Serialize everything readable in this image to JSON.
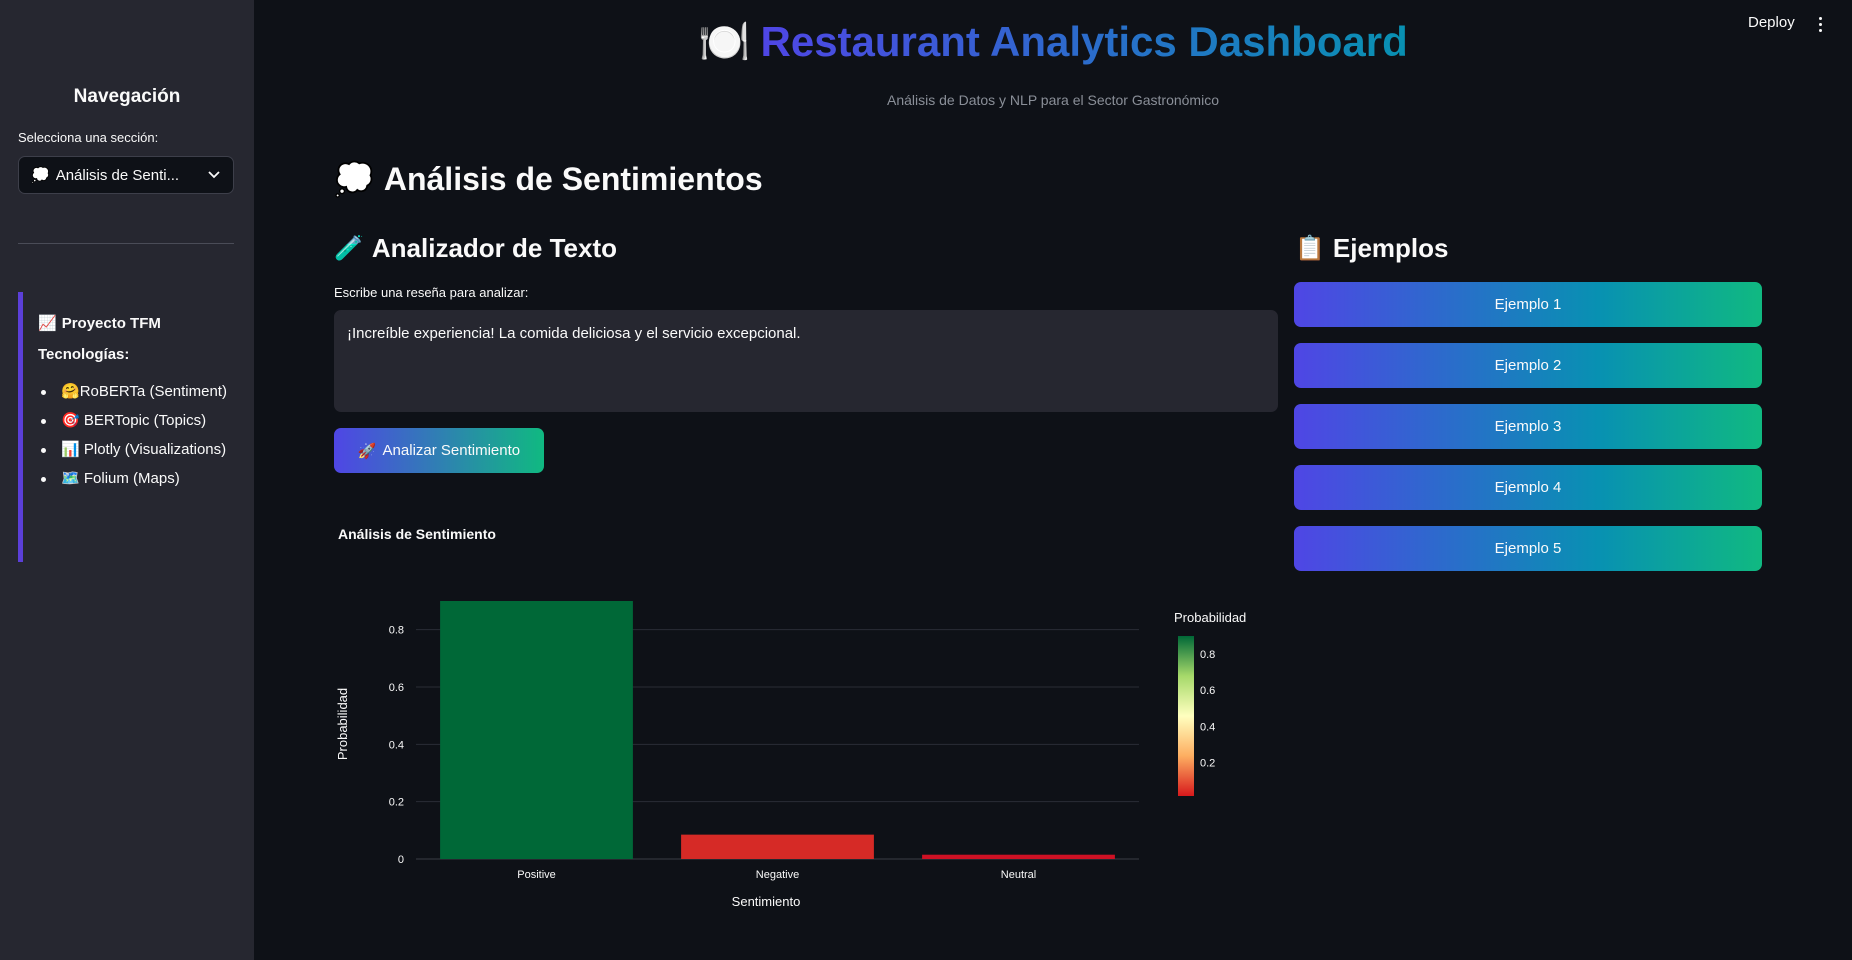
{
  "header": {
    "deploy_label": "Deploy",
    "title_icon": "🍽️",
    "title": "Restaurant Analytics Dashboard",
    "subtitle": "Análisis de Datos y NLP para el Sector Gastronómico"
  },
  "sidebar": {
    "title": "Navegación",
    "select_label": "Selecciona una sección:",
    "select_icon": "💭",
    "select_value": "Análisis de Senti...",
    "project_icon": "📈",
    "project_title": "Proyecto TFM",
    "tech_title": "Tecnologías:",
    "tech_items": [
      {
        "icon": "🤗",
        "label": "RoBERTa (Sentiment)"
      },
      {
        "icon": "🎯",
        "label": "BERTopic (Topics)"
      },
      {
        "icon": "📊",
        "label": "Plotly (Visualizations)"
      },
      {
        "icon": "🗺️",
        "label": "Folium (Maps)"
      }
    ]
  },
  "section": {
    "icon": "💭",
    "title": "Análisis de Sentimientos"
  },
  "analyzer": {
    "icon": "🧪",
    "title": "Analizador de Texto",
    "input_label": "Escribe una reseña para analizar:",
    "input_value": "¡Increíble experiencia! La comida deliciosa y el servicio excepcional.",
    "button_icon": "🚀",
    "button_label": "Analizar Sentimiento"
  },
  "examples": {
    "icon": "📋",
    "title": "Ejemplos",
    "buttons": [
      "Ejemplo 1",
      "Ejemplo 2",
      "Ejemplo 3",
      "Ejemplo 4",
      "Ejemplo 5"
    ]
  },
  "chart_data": {
    "type": "bar",
    "title": "Análisis de Sentimiento",
    "categories": [
      "Positive",
      "Negative",
      "Neutral"
    ],
    "values": [
      0.9,
      0.085,
      0.015
    ],
    "xlabel": "Sentimiento",
    "ylabel": "Probabilidad",
    "ylim": [
      0,
      0.9
    ],
    "yticks": [
      0,
      0.2,
      0.4,
      0.6,
      0.8
    ],
    "ytick_labels": [
      "0",
      "0.2",
      "0.4",
      "0.6",
      "0.8"
    ],
    "grid": true,
    "colorbar": {
      "title": "Probabilidad",
      "ticks": [
        0.2,
        0.4,
        0.6,
        0.8
      ],
      "tick_labels": [
        "0.2",
        "0.4",
        "0.6",
        "0.8"
      ],
      "range": [
        0.015,
        0.9
      ],
      "colors": [
        "#d7191c",
        "#fdae61",
        "#ffffbf",
        "#a6d96a",
        "#006837"
      ]
    },
    "bar_colors": [
      "#006837",
      "#d62a26",
      "#ce1124"
    ]
  }
}
